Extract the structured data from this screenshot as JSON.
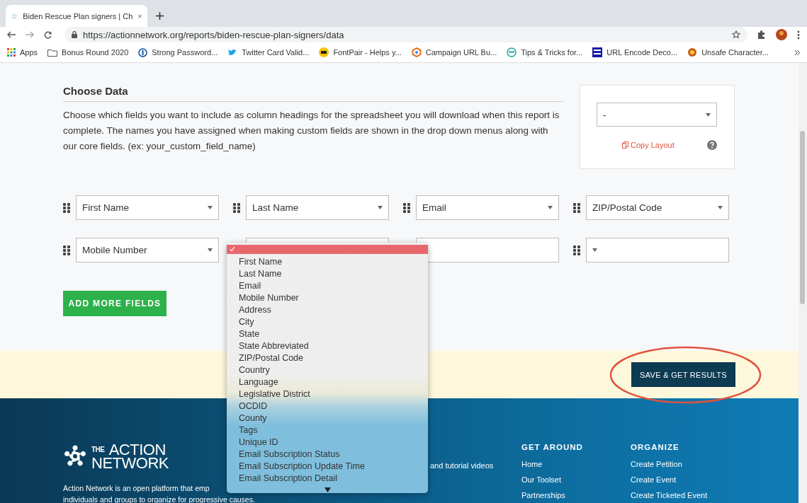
{
  "browser": {
    "tab": {
      "title": "Biden Rescue Plan signers | Ch"
    },
    "url": "https://actionnetwork.org/reports/biden-rescue-plan-signers/data",
    "bookmarks": [
      {
        "label": "Apps",
        "kind": "apps"
      },
      {
        "label": "Bonus Round 2020",
        "kind": "folder"
      },
      {
        "label": "Strong Password...",
        "kind": "key"
      },
      {
        "label": "Twitter Card Valid...",
        "kind": "bird"
      },
      {
        "label": "FontPair - Helps y...",
        "kind": "font"
      },
      {
        "label": "Campaign URL Bu...",
        "kind": "hex"
      },
      {
        "label": "Tips & Tricks for...",
        "kind": "tips"
      },
      {
        "label": "URL Encode Deco...",
        "kind": "square"
      },
      {
        "label": "Unsafe Character...",
        "kind": "gear"
      }
    ]
  },
  "section": {
    "title": "Choose Data",
    "description": "Choose which fields you want to include as column headings for the spreadsheet you will download when this report is complete. The names you have assigned when making custom fields are shown in the drop down menus along with our core fields. (ex: your_custom_field_name)",
    "layout_select": {
      "value": "-"
    },
    "copy_link": "Copy Layout"
  },
  "fields": [
    [
      {
        "value": "First Name",
        "expanded": false
      },
      {
        "value": "Last Name",
        "expanded": false
      },
      {
        "value": "Email",
        "expanded": false
      },
      {
        "value": "ZIP/Postal Code",
        "expanded": false
      }
    ],
    [
      {
        "value": "Mobile Number",
        "expanded": false
      },
      {
        "expanded": true
      },
      {
        "expanded": false
      },
      {
        "expanded": false
      }
    ]
  ],
  "dropdown": {
    "options": [
      {
        "selected": true
      },
      {
        "label": "First Name",
        "selected": false
      },
      {
        "label": "Last Name",
        "selected": false
      },
      {
        "label": "Email",
        "selected": false
      },
      {
        "label": "Mobile Number",
        "selected": false
      },
      {
        "label": "Address",
        "selected": false
      },
      {
        "label": "City",
        "selected": false
      },
      {
        "label": "State",
        "selected": false
      },
      {
        "label": "State Abbreviated",
        "selected": false
      },
      {
        "label": "ZIP/Postal Code",
        "selected": false
      },
      {
        "label": "Country",
        "selected": false
      },
      {
        "label": "Language",
        "selected": false
      },
      {
        "label": "Legislative District",
        "selected": false
      },
      {
        "label": "OCDID",
        "selected": false
      },
      {
        "label": "County",
        "selected": false
      },
      {
        "label": "Tags",
        "selected": false
      },
      {
        "label": "Unique ID",
        "selected": false
      },
      {
        "label": "Email Subscription Status",
        "selected": false
      },
      {
        "label": "Email Subscription Update Time",
        "selected": false
      },
      {
        "label": "Email Subscription Detail",
        "selected": false
      }
    ]
  },
  "add_button": "ADD MORE FIELDS",
  "save_button": "SAVE & GET RESULTS",
  "footer": {
    "logo": [
      "THE",
      "ACTION",
      "NETWORK"
    ],
    "about": [
      "Action Network is an open platform that emp",
      "individuals and groups to organize for progressive causes."
    ],
    "middle_text": "and tutorial videos",
    "columns": [
      {
        "title": "GET AROUND",
        "links": [
          "Home",
          "Our Toolset",
          "Partnerships"
        ]
      },
      {
        "title": "ORGANIZE",
        "links": [
          "Create Petition",
          "Create Event",
          "Create Ticketed Event"
        ]
      }
    ]
  }
}
